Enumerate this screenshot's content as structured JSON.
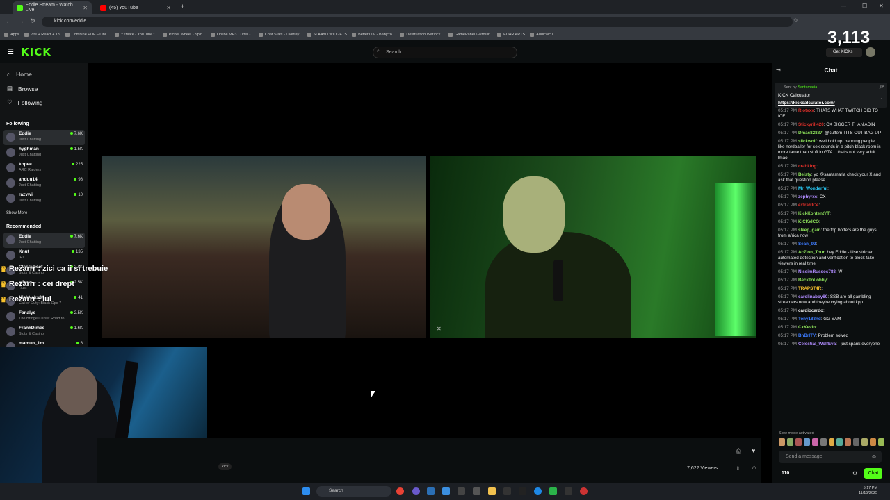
{
  "browser": {
    "tabs": [
      {
        "title": "Eddie Stream - Watch Live",
        "color": "#53fc18"
      },
      {
        "title": "(45) YouTube",
        "color": "#ff0000"
      }
    ],
    "url": "kick.com/eddie",
    "bookmarks": [
      "Apps",
      "Vite + React + TS",
      "Combine PDF – Onli...",
      "Y2Mate - YouTube t...",
      "Picker Wheel - Spin...",
      "Online MP3 Cutter -...",
      "Chat Stats - Overlay...",
      "SLAAYD WIDGETS",
      "BetterTTV - BabyYo...",
      "Destruction Warlock...",
      "GamePanel Gazduir...",
      "EUAR ARTS",
      "Audicalcu"
    ]
  },
  "header": {
    "logo": "KICK",
    "search_placeholder": "Search",
    "counter": "3,113",
    "get_kicks": "Get KICKs"
  },
  "sidebar": {
    "nav": [
      {
        "label": "Home",
        "icon": "home-icon"
      },
      {
        "label": "Browse",
        "icon": "browse-icon"
      },
      {
        "label": "Following",
        "icon": "heart-icon"
      }
    ],
    "following_title": "Following",
    "following": [
      {
        "name": "Eddie",
        "category": "Just Chatting",
        "viewers": "7.6K"
      },
      {
        "name": "hyghman",
        "category": "Just Chatting",
        "viewers": "1.5K"
      },
      {
        "name": "kopee",
        "category": "ARC Raiders",
        "viewers": "225"
      },
      {
        "name": "anduu14",
        "category": "Just Chatting",
        "viewers": "98"
      },
      {
        "name": "razvwi",
        "category": "Just Chatting",
        "viewers": "10"
      }
    ],
    "show_more": "Show More",
    "recommended_title": "Recommended",
    "recommended": [
      {
        "name": "Eddie",
        "category": "Just Chatting",
        "viewers": "7.6K"
      },
      {
        "name": "Knut",
        "category": "IRL",
        "viewers": "135"
      },
      {
        "name": "Classybeef",
        "category": "Slots & Casino",
        "viewers": "2.5K"
      },
      {
        "name": "oilrats",
        "category": "Rust",
        "viewers": "2.5K"
      },
      {
        "name": "NickNaks34",
        "category": "Call of Duty: Black Ops 7",
        "viewers": "41"
      },
      {
        "name": "Fanalys",
        "category": "The Bridge Curse: Road to ...",
        "viewers": "2.5K"
      },
      {
        "name": "FrankDimes",
        "category": "Slots & Casino",
        "viewers": "1.6K"
      },
      {
        "name": "mamun_1m",
        "category": "",
        "viewers": "6"
      }
    ]
  },
  "overlay_chat": [
    {
      "user": "Rezarrr",
      "text": "zici ca ii si trebuie"
    },
    {
      "user": "Rezarrr",
      "text": "cei drept"
    },
    {
      "user": "Rezarrr",
      "text": "lui"
    }
  ],
  "stream": {
    "viewers": "7,622 Viewers",
    "tag": "kick"
  },
  "chat": {
    "title": "Chat",
    "pinned": {
      "sent_by": "Sent by",
      "sender": "Santamaria",
      "text": "KICK Calculator",
      "link": "https://kickcalculator.com/"
    },
    "messages": [
      {
        "time": "05:17 PM",
        "user": "Riotxxx",
        "color": "#e0302a",
        "text": "THATS WHAT TWITCH DID TO ICE"
      },
      {
        "time": "05:17 PM",
        "user": "Stickyrill420",
        "color": "#e0302a",
        "text": "CX BIGGER THAN ADIN"
      },
      {
        "time": "05:17 PM",
        "user": "Dmac82887",
        "color": "#8fe35c",
        "text": "@cuffem TITS OUT BAG UP"
      },
      {
        "time": "05:17 PM",
        "user": "slickwolf",
        "color": "#8fe35c",
        "text": "well hold up, banning people like nerdballer for sex sounds in a pitch black room is more tame than stuff in GTA... that's not very adult lmao"
      },
      {
        "time": "05:17 PM",
        "user": "crabking",
        "color": "#e0302a",
        "text": ""
      },
      {
        "time": "05:17 PM",
        "user": "Beisty",
        "color": "#8fe35c",
        "text": "yo @santamaria check your X and ask that question please"
      },
      {
        "time": "05:17 PM",
        "user": "Mr_Wonderful",
        "color": "#29d0ff",
        "text": ""
      },
      {
        "time": "05:17 PM",
        "user": "zephyrxc",
        "color": "#b18cff",
        "text": "CX"
      },
      {
        "time": "05:17 PM",
        "user": "extraRICe",
        "color": "#e0302a",
        "text": ""
      },
      {
        "time": "05:17 PM",
        "user": "KickKontentYT",
        "color": "#8fe35c",
        "text": ""
      },
      {
        "time": "05:17 PM",
        "user": "KICKxICO",
        "color": "#8fe35c",
        "text": ""
      },
      {
        "time": "05:17 PM",
        "user": "sleep_gain",
        "color": "#8fe35c",
        "text": "the top botters are the guys from africa now"
      },
      {
        "time": "05:17 PM",
        "user": "Sean_92",
        "color": "#3c7bff",
        "text": ""
      },
      {
        "time": "05:17 PM",
        "user": "Ac7ion_Tour",
        "color": "#8fe35c",
        "text": "hey Eddie - Use stricter automated detection and verification to block fake viewers in real time"
      },
      {
        "time": "05:17 PM",
        "user": "NissimRussos788",
        "color": "#b18cff",
        "text": "W"
      },
      {
        "time": "05:17 PM",
        "user": "BeckToLobby",
        "color": "#8fe35c",
        "text": ""
      },
      {
        "time": "05:17 PM",
        "user": "TRAPST4R",
        "color": "#f7c12d",
        "text": ""
      },
      {
        "time": "05:17 PM",
        "user": "carolinaboy80",
        "color": "#b18cff",
        "text": "SSB are all gambling streamers now and they're crying about kpp"
      },
      {
        "time": "05:17 PM",
        "user": "cardiocardo",
        "color": "#eee",
        "text": ""
      },
      {
        "time": "05:17 PM",
        "user": "Tony183nd",
        "color": "#3c7bff",
        "text": "GG SAM"
      },
      {
        "time": "05:17 PM",
        "user": "CxKevin",
        "color": "#8fe35c",
        "text": ""
      },
      {
        "time": "05:17 PM",
        "user": "BnBrITV",
        "color": "#3c7bff",
        "text": "Problem solved"
      },
      {
        "time": "05:17 PM",
        "user": "Celestial_WolfEva",
        "color": "#b18cff",
        "text": "I just spank everyone"
      }
    ],
    "slow_mode": "Slow mode activated",
    "input_placeholder": "Send a message",
    "points": "110",
    "chat_button": "Chat"
  },
  "taskbar": {
    "search": "Search",
    "time": "5:17 PM",
    "date": "11/15/2025"
  }
}
